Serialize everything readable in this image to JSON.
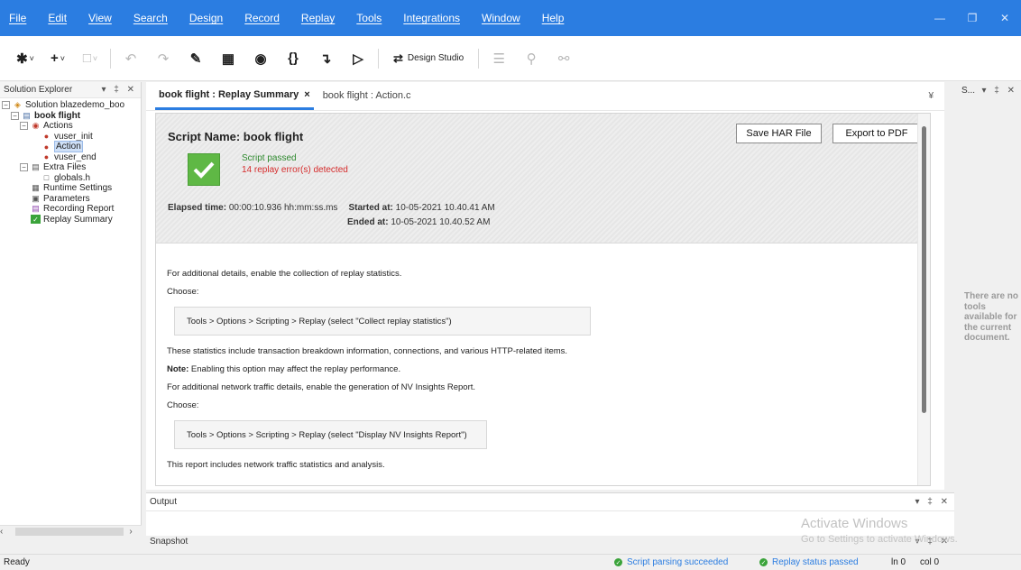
{
  "menu": [
    "File",
    "Edit",
    "View",
    "Search",
    "Design",
    "Record",
    "Replay",
    "Tools",
    "Integrations",
    "Window",
    "Help"
  ],
  "toolbar": {
    "design_studio_label": "Design Studio",
    "icons": [
      "asterisk-menu-icon",
      "add-menu-icon",
      "save-icon",
      "undo-icon",
      "redo-icon",
      "script-icon",
      "compare-icon",
      "record-icon",
      "braces-icon",
      "step-into-icon",
      "play-icon",
      "design-studio-icon",
      "list-icon",
      "search-icon",
      "zoom-icon"
    ]
  },
  "solution_explorer": {
    "title": "Solution Explorer",
    "tree": [
      {
        "label": "Solution blazedemo_boo",
        "level": 0
      },
      {
        "label": "book flight",
        "level": 1,
        "bold": true
      },
      {
        "label": "Actions",
        "level": 2
      },
      {
        "label": "vuser_init",
        "level": 3
      },
      {
        "label": "Action",
        "level": 3,
        "selected": true
      },
      {
        "label": "vuser_end",
        "level": 3
      },
      {
        "label": "Extra Files",
        "level": 2
      },
      {
        "label": "globals.h",
        "level": 3
      },
      {
        "label": "Runtime Settings",
        "level": 2
      },
      {
        "label": "Parameters",
        "level": 2
      },
      {
        "label": "Recording Report",
        "level": 2
      },
      {
        "label": "Replay Summary",
        "level": 2
      }
    ]
  },
  "tabs": {
    "active": "book flight : Replay Summary",
    "close_symbol": "×",
    "second": "book flight : Action.c",
    "overflow_symbol": "¥"
  },
  "summary": {
    "script_name": "Script Name: book flight",
    "status_passed": "Script passed",
    "status_errors": "14 replay error(s) detected",
    "elapsed_label": "Elapsed time:",
    "elapsed_value": "00:00:10.936 hh:mm:ss.ms",
    "started_label": "Started at:",
    "started_value": "10-05-2021 10.40.41 AM",
    "ended_label": "Ended at:",
    "ended_value": "10-05-2021 10.40.52 AM",
    "save_har": "Save HAR File",
    "export_pdf": "Export to PDF"
  },
  "body": {
    "p1": "For additional details, enable the collection of replay statistics.",
    "choose1": "Choose:",
    "code1": "Tools > Options > Scripting > Replay (select \"Collect replay statistics\")",
    "p2": "These statistics include transaction breakdown information, connections, and various HTTP-related items.",
    "note_label": "Note:",
    "note_text": "Enabling this option may affect the replay performance.",
    "p3": "For additional network traffic details, enable the generation of NV Insights Report.",
    "choose2": "Choose:",
    "code2": "Tools > Options > Scripting > Replay (select \"Display NV Insights Report\")",
    "p4": "This report includes network traffic statistics and analysis."
  },
  "right_panel": {
    "title": "S...",
    "message": "There are no tools available for the current document."
  },
  "output": {
    "title": "Output"
  },
  "snapshot": {
    "title": "Snapshot"
  },
  "watermark": {
    "line1": "Activate Windows",
    "line2": "Go to Settings to activate Windows."
  },
  "statusbar": {
    "ready": "Ready",
    "parsing": "Script parsing succeeded",
    "replay": "Replay status passed",
    "ln": "ln 0",
    "col": "col 0"
  },
  "colors": {
    "menubar": "#2b7de1",
    "pass_green": "#5fb845",
    "error_red": "#d52b2b",
    "status_blue": "#2b7de1"
  }
}
